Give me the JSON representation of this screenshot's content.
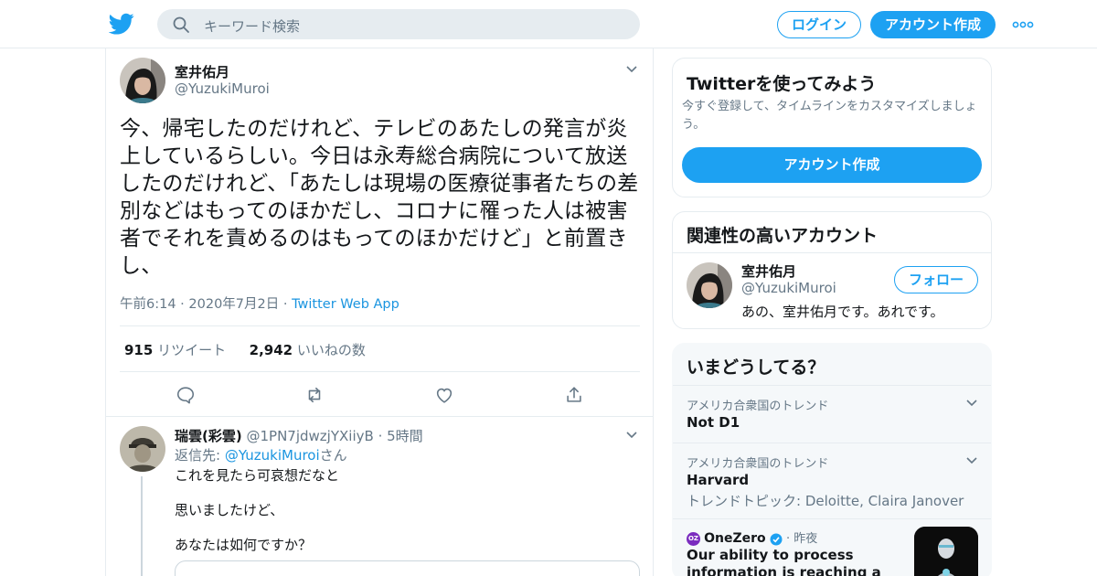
{
  "header": {
    "search_placeholder": "キーワード検索",
    "login_label": "ログイン",
    "signup_label": "アカウント作成"
  },
  "tweet": {
    "name": "室井佑月",
    "handle": "@YuzukiMuroi",
    "text": "今、帰宅したのだけれど、テレビのあたしの発言が炎上しているらしい。今日は永寿総合病院について放送したのだけれど、「あたしは現場の医療従事者たちの差別などはもってのほかだし、コロナに罹った人は被害者でそれを責めるのはもってのほかだけど」と前置きし、",
    "time": "午前6:14",
    "date": "2020年7月2日",
    "source": "Twitter Web App",
    "retweets_count": "915",
    "retweets_label": "リツイート",
    "likes_count": "2,942",
    "likes_label": "いいねの数"
  },
  "reply": {
    "name": "瑞雲(彩雲)",
    "handle": "@1PN7jdwzjYXiiyB",
    "age": "5時間",
    "replying_prefix": "返信先: ",
    "replying_to": "@YuzukiMuroi",
    "replying_suffix": "さん",
    "lines": [
      "これを見たら可哀想だなと",
      "思いましたけど、",
      "あなたは如何ですか？"
    ]
  },
  "sidebar": {
    "try_title": "Twitterを使ってみよう",
    "try_desc": "今すぐ登録して、タイムラインをカスタマイズしましょう。",
    "try_button": "アカウント作成",
    "related_title": "関連性の高いアカウント",
    "related": {
      "name": "室井佑月",
      "handle": "@YuzukiMuroi",
      "bio": "あの、室井佑月です。あれです。",
      "follow_label": "フォロー"
    },
    "trends_title": "いまどうしてる？",
    "trends": [
      {
        "context": "アメリカ合衆国のトレンド",
        "name": "Not D1"
      },
      {
        "context": "アメリカ合衆国のトレンド",
        "name": "Harvard",
        "topic": "トレンドトピック: Deloitte, Claira Janover"
      }
    ],
    "news": {
      "badge": "OZ",
      "source": "OneZero",
      "time": "昨夜",
      "title": "Our ability to process information is reaching a critical limit"
    }
  },
  "colors": {
    "accent": "#1da1f2",
    "link": "#1b95e0",
    "secondary_text": "#657786",
    "border": "#e6ecf0"
  }
}
